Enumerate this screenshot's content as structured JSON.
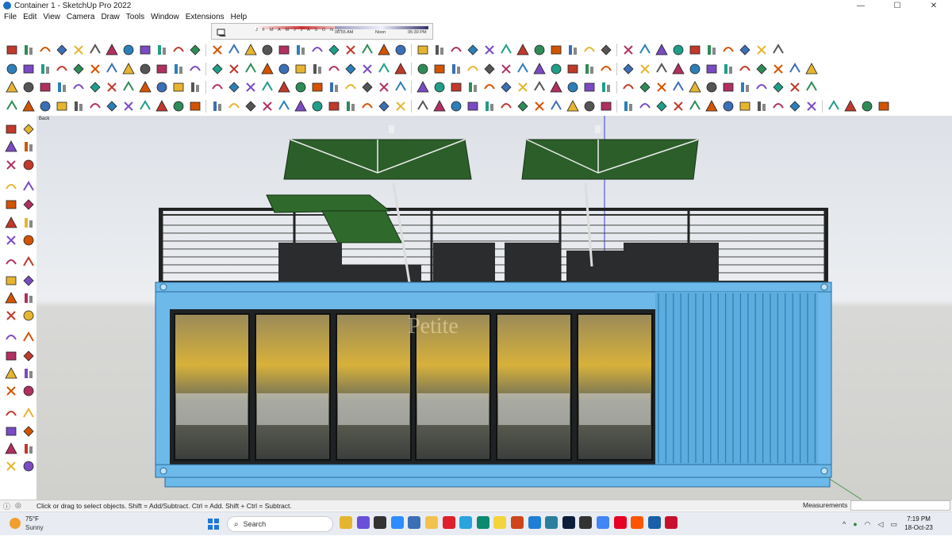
{
  "window": {
    "title": "Container 1 - SketchUp Pro 2022",
    "min": "—",
    "max": "☐",
    "close": "✕"
  },
  "menu": [
    "File",
    "Edit",
    "View",
    "Camera",
    "Draw",
    "Tools",
    "Window",
    "Extensions",
    "Help"
  ],
  "shadows": {
    "months": "J F M A M J J A S O N D",
    "time_start": "06:55 AM",
    "time_mid": "Noon",
    "time_end": "05:30 PM"
  },
  "scene": {
    "tab_label": "Back",
    "sign_text": "Petite"
  },
  "status": {
    "message": "Click or drag to select objects. Shift = Add/Subtract. Ctrl = Add. Shift + Ctrl = Subtract.",
    "measurements_label": "Measurements",
    "measurements_value": ""
  },
  "taskbar": {
    "weather_temp": "75°F",
    "weather_desc": "Sunny",
    "search_label": "Search",
    "clock_time": "7:19 PM",
    "clock_date": "18-Oct-23",
    "apps": [
      {
        "name": "file-explorer",
        "color": "#e6b530"
      },
      {
        "name": "app-copilot",
        "color": "#6a4fd8"
      },
      {
        "name": "task-view",
        "color": "#333333"
      },
      {
        "name": "zoom",
        "color": "#2d8cff"
      },
      {
        "name": "calculator",
        "color": "#3b6fb6"
      },
      {
        "name": "folder",
        "color": "#f2c14e"
      },
      {
        "name": "opera",
        "color": "#e0202a"
      },
      {
        "name": "telegram",
        "color": "#2aa3e0"
      },
      {
        "name": "sketch-app",
        "color": "#0b8a6f"
      },
      {
        "name": "sticky-notes",
        "color": "#f5d33c"
      },
      {
        "name": "grammarly-app",
        "color": "#d0441b"
      },
      {
        "name": "vs-code",
        "color": "#1f7fd6"
      },
      {
        "name": "image-viewer",
        "color": "#2a7f9c"
      },
      {
        "name": "photoshop",
        "color": "#0b1d3a"
      },
      {
        "name": "vectorworks",
        "color": "#333333"
      },
      {
        "name": "chrome",
        "color": "#4285f4"
      },
      {
        "name": "pinterest",
        "color": "#e60023"
      },
      {
        "name": "soundcloud",
        "color": "#ff5500"
      },
      {
        "name": "sketchup",
        "color": "#1a5fa8"
      },
      {
        "name": "autocad",
        "color": "#c8102e"
      }
    ]
  },
  "colors": {
    "container_blue": "#6cb9ea",
    "umbrella_green": "#2c5e2a",
    "frame_dark": "#222222",
    "sky": "#e4e7ec",
    "ground": "#d2d2cf"
  }
}
